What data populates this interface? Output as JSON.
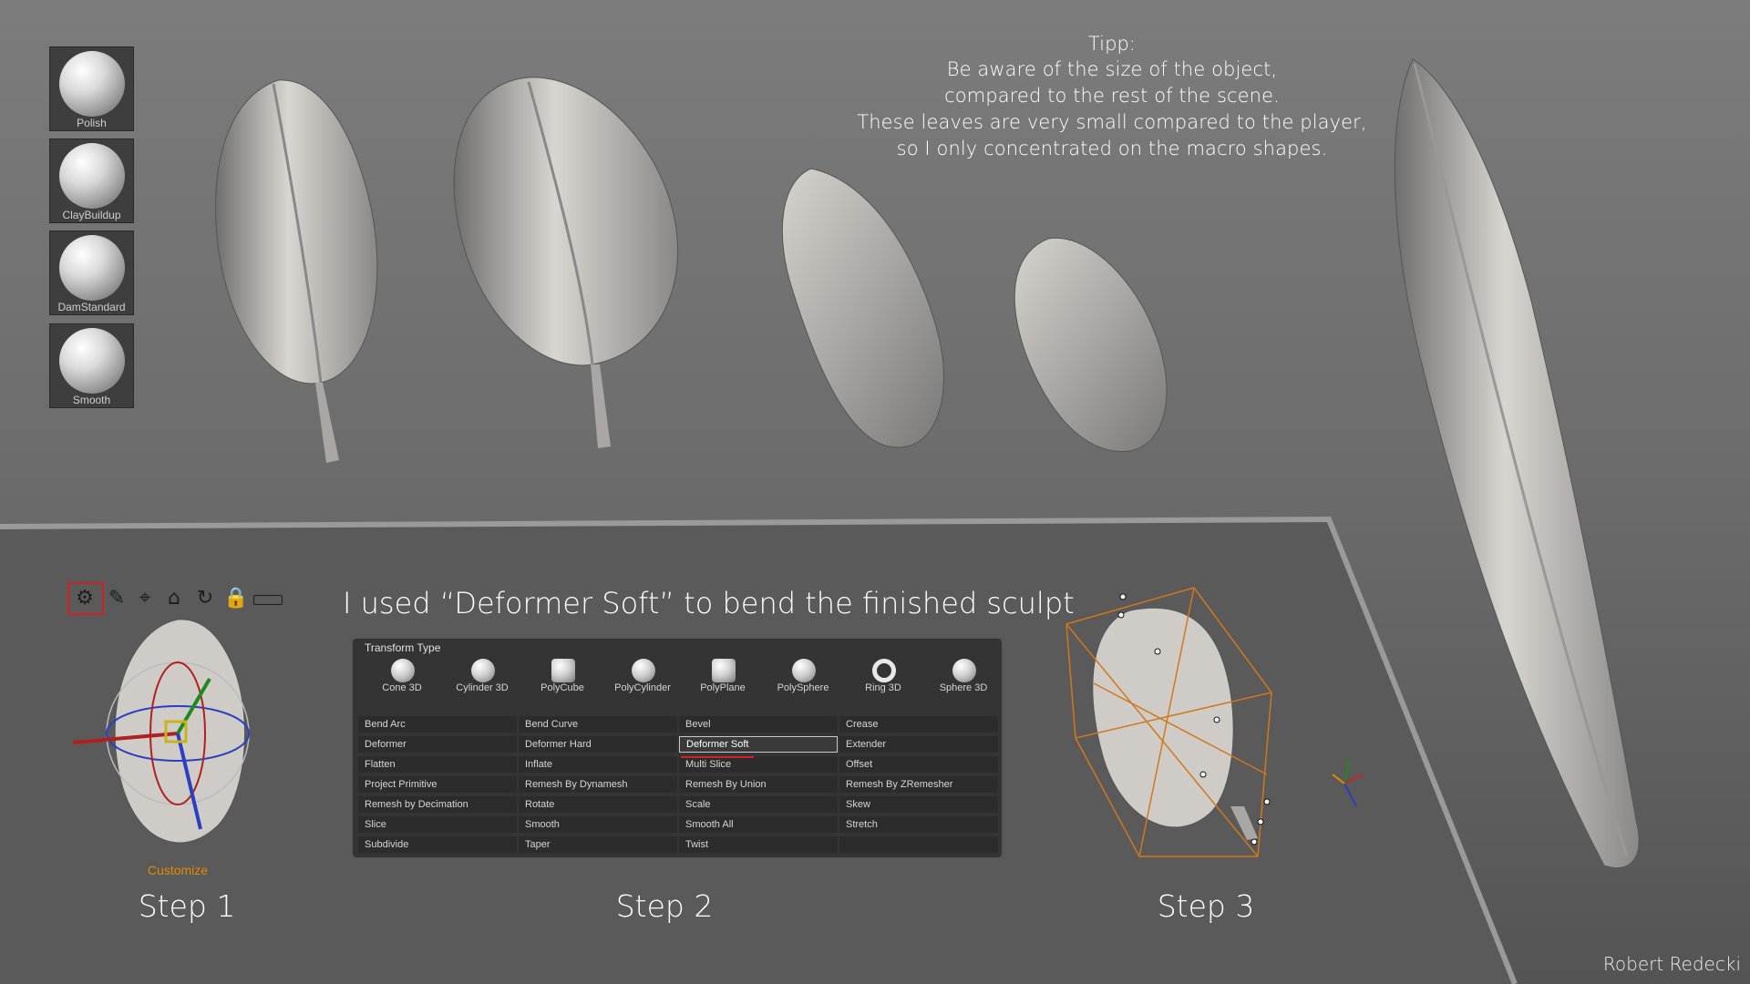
{
  "brushes": [
    {
      "name": "Polish",
      "icon": "polish-brush-icon"
    },
    {
      "name": "ClayBuildup",
      "icon": "claybuildup-brush-icon"
    },
    {
      "name": "DamStandard",
      "icon": "damstandard-brush-icon"
    },
    {
      "name": "Smooth",
      "icon": "smooth-brush-icon"
    }
  ],
  "tip": {
    "title": "Tipp:",
    "lines": [
      "Be aware of the size of the object,",
      "compared to the rest of the scene.",
      "These leaves are very small compared to the player,",
      "so I only concentrated on the macro shapes."
    ]
  },
  "heading": "I used “Deformer Soft” to bend the finished sculpt",
  "toolbar": {
    "icons": [
      "gear-icon",
      "pin-icon",
      "location-icon",
      "home-icon",
      "rotate-icon",
      "lock-icon",
      "toggle-icon"
    ],
    "customize_label": "Customize"
  },
  "panel": {
    "title": "Transform Type",
    "primitives": [
      "Cone 3D",
      "Cylinder 3D",
      "PolyCube",
      "PolyCylinder",
      "PolyPlane",
      "PolySphere",
      "Ring 3D",
      "Sphere 3D"
    ],
    "rows": [
      [
        "Bend Arc",
        "Bend Curve",
        "Bevel",
        "Crease"
      ],
      [
        "Deformer",
        "Deformer Hard",
        "Deformer Soft",
        "Extender"
      ],
      [
        "Flatten",
        "Inflate",
        "Multi Slice",
        "Offset"
      ],
      [
        "Project Primitive",
        "Remesh By Dynamesh",
        "Remesh By Union",
        "Remesh By ZRemesher"
      ],
      [
        "Remesh by Decimation",
        "Rotate",
        "Scale",
        "Skew"
      ],
      [
        "Slice",
        "Smooth",
        "Smooth All",
        "Stretch"
      ],
      [
        "Subdivide",
        "Taper",
        "Twist",
        ""
      ]
    ],
    "selected": "Deformer Soft"
  },
  "steps": [
    "Step 1",
    "Step 2",
    "Step 3"
  ],
  "author": "Robert Redecki",
  "colors": {
    "highlight": "#d42020",
    "accent": "#e58a00",
    "text": "#ffffff",
    "panel": "#343434"
  }
}
